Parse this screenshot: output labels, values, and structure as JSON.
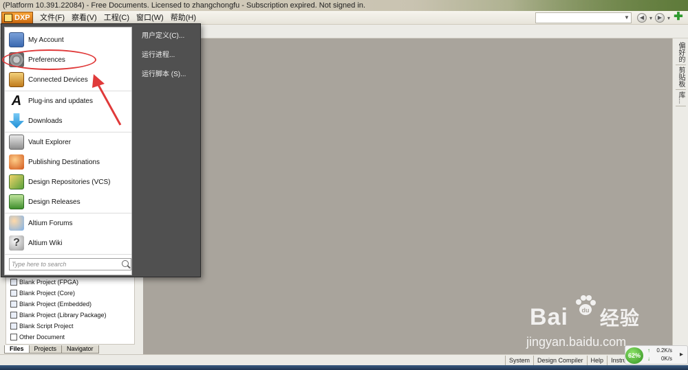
{
  "window": {
    "title": "(Platform 10.391.22084) - Free Documents. Licensed to zhangchongfu - Subscription expired. Not signed in."
  },
  "menubar": {
    "dxp_label": "DXP",
    "items": [
      "文件(F)",
      "察看(V)",
      "工程(C)",
      "窗口(W)",
      "帮助(H)"
    ]
  },
  "dxp_menu": {
    "items": [
      {
        "label": "My Account",
        "icon": "account-icon"
      },
      {
        "label": "Preferences",
        "icon": "gear-icon"
      },
      {
        "label": "Connected Devices",
        "icon": "devices-icon"
      },
      {
        "label": "Plug-ins and updates",
        "icon": "plugin-icon"
      },
      {
        "label": "Downloads",
        "icon": "download-arrow-icon"
      },
      {
        "label": "Vault Explorer",
        "icon": "vault-icon"
      },
      {
        "label": "Publishing Destinations",
        "icon": "publish-icon"
      },
      {
        "label": "Design Repositories (VCS)",
        "icon": "repository-icon"
      },
      {
        "label": "Design Releases",
        "icon": "releases-icon"
      },
      {
        "label": "Altium Forums",
        "icon": "forums-icon"
      },
      {
        "label": "Altium Wiki",
        "icon": "help-icon"
      }
    ],
    "search_placeholder": "Type here to search",
    "right_items": [
      "用户定义(C)...",
      "运行进程...",
      "运行脚本 (S)..."
    ]
  },
  "files_panel": {
    "items": [
      "Blank Project (FPGA)",
      "Blank Project (Core)",
      "Blank Project (Embedded)",
      "Blank Project (Library Package)",
      "Blank Script Project",
      "Other Document"
    ],
    "tabs": [
      "Files",
      "Projects",
      "Navigator"
    ]
  },
  "right_panel_tabs": [
    "偏好的",
    "剪贴板",
    "库..."
  ],
  "statusbar": {
    "items": [
      "System",
      "Design Compiler",
      "Help",
      "Instruments"
    ]
  },
  "network": {
    "percent": "62%",
    "upload": "0.2K/s",
    "download": "0K/s"
  },
  "watermark": {
    "brand": "Bai",
    "brand_cn": "经验",
    "url": "jingyan.baidu.com"
  },
  "colors": {
    "workspace": "#a9a49c",
    "menu_dark": "#505050",
    "annotation_red": "#e03a3a",
    "dxp_orange": "#e88a25"
  }
}
